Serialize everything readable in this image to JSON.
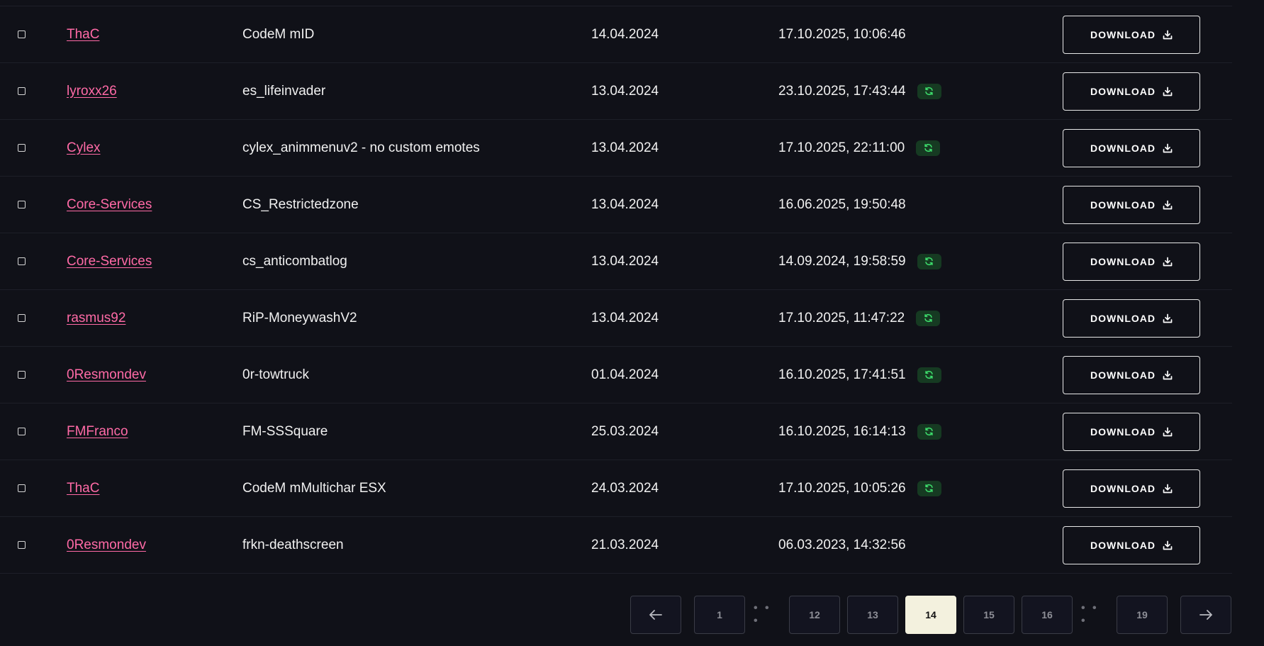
{
  "rows": [
    {
      "author": "ThaC",
      "name": "CodeM mID",
      "date": "14.04.2024",
      "updated": "17.10.2025, 10:06:46",
      "synced": false,
      "action": "DOWNLOAD"
    },
    {
      "author": "lyroxx26",
      "name": "es_lifeinvader",
      "date": "13.04.2024",
      "updated": "23.10.2025, 17:43:44",
      "synced": true,
      "action": "DOWNLOAD"
    },
    {
      "author": "Cylex",
      "name": "cylex_animmenuv2 - no custom emotes",
      "date": "13.04.2024",
      "updated": "17.10.2025, 22:11:00",
      "synced": true,
      "action": "DOWNLOAD"
    },
    {
      "author": "Core-Services",
      "name": "CS_Restrictedzone",
      "date": "13.04.2024",
      "updated": "16.06.2025, 19:50:48",
      "synced": false,
      "action": "DOWNLOAD"
    },
    {
      "author": "Core-Services",
      "name": "cs_anticombatlog",
      "date": "13.04.2024",
      "updated": "14.09.2024, 19:58:59",
      "synced": true,
      "action": "DOWNLOAD"
    },
    {
      "author": "rasmus92",
      "name": "RiP-MoneywashV2",
      "date": "13.04.2024",
      "updated": "17.10.2025, 11:47:22",
      "synced": true,
      "action": "DOWNLOAD"
    },
    {
      "author": "0Resmondev",
      "name": "0r-towtruck",
      "date": "01.04.2024",
      "updated": "16.10.2025, 17:41:51",
      "synced": true,
      "action": "DOWNLOAD"
    },
    {
      "author": "FMFranco",
      "name": "FM-SSSquare",
      "date": "25.03.2024",
      "updated": "16.10.2025, 16:14:13",
      "synced": true,
      "action": "DOWNLOAD"
    },
    {
      "author": "ThaC",
      "name": "CodeM mMultichar ESX",
      "date": "24.03.2024",
      "updated": "17.10.2025, 10:05:26",
      "synced": true,
      "action": "DOWNLOAD"
    },
    {
      "author": "0Resmondev",
      "name": "frkn-deathscreen",
      "date": "21.03.2024",
      "updated": "06.03.2023, 14:32:56",
      "synced": false,
      "action": "DOWNLOAD"
    }
  ],
  "pagination": {
    "prev_icon": "arrow-left-icon",
    "next_icon": "arrow-right-icon",
    "ellipsis": "• • •",
    "pages": [
      {
        "label": "1",
        "active": false
      },
      {
        "label": "12",
        "active": false
      },
      {
        "label": "13",
        "active": false
      },
      {
        "label": "14",
        "active": true
      },
      {
        "label": "15",
        "active": false
      },
      {
        "label": "16",
        "active": false
      },
      {
        "label": "19",
        "active": false
      }
    ]
  },
  "colors": {
    "background": "#101118",
    "author_link": "#ff6aa6",
    "sync_badge_bg": "#163a22",
    "sync_icon": "#3ddc6b",
    "active_page_bg": "#f3f1de"
  }
}
